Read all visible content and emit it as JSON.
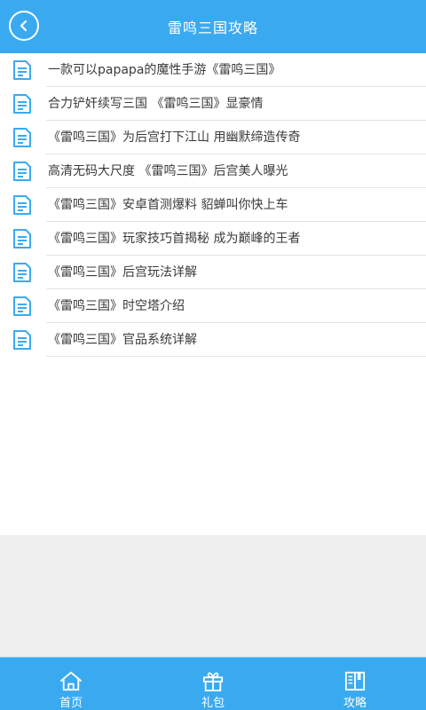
{
  "header": {
    "title": "雷鸣三国攻略"
  },
  "articles": [
    {
      "title": "一款可以papapa的魔性手游《雷鸣三国》"
    },
    {
      "title": "合力铲奸续写三国 《雷鸣三国》显豪情"
    },
    {
      "title": "《雷鸣三国》为后宫打下江山 用幽默缔造传奇"
    },
    {
      "title": "高清无码大尺度 《雷鸣三国》后宫美人曝光"
    },
    {
      "title": "《雷鸣三国》安卓首测爆料 貂蝉叫你快上车"
    },
    {
      "title": "《雷鸣三国》玩家技巧首揭秘 成为巅峰的王者"
    },
    {
      "title": "《雷鸣三国》后宫玩法详解"
    },
    {
      "title": "《雷鸣三国》时空塔介绍"
    },
    {
      "title": "《雷鸣三国》官品系统详解"
    }
  ],
  "tabs": [
    {
      "label": "首页",
      "icon": "home-icon"
    },
    {
      "label": "礼包",
      "icon": "gift-icon"
    },
    {
      "label": "攻略",
      "icon": "book-icon"
    }
  ],
  "colors": {
    "accent": "#3aaaf0",
    "background": "#efefef",
    "divider": "#e3e3e3"
  }
}
